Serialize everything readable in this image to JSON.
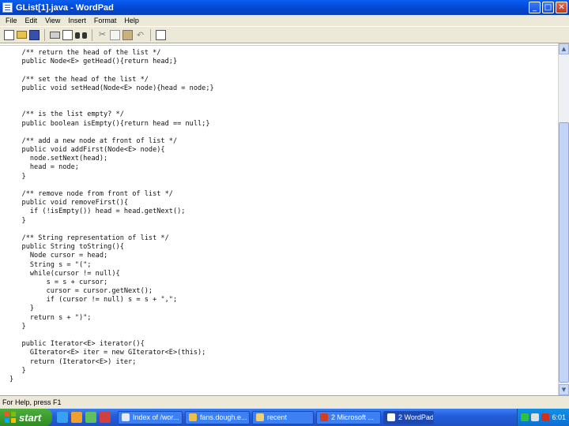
{
  "window": {
    "title": "GList[1].java - WordPad",
    "minimize_glyph": "_",
    "maximize_glyph": "□",
    "close_glyph": "✕"
  },
  "menu": [
    "File",
    "Edit",
    "View",
    "Insert",
    "Format",
    "Help"
  ],
  "toolbar": {
    "icons": [
      "new-document-icon",
      "open-folder-icon",
      "save-disk-icon",
      "print-icon",
      "print-preview-icon",
      "find-binoculars-icon",
      "cut-scissors-icon",
      "copy-icon",
      "paste-icon",
      "undo-icon",
      "date-time-icon"
    ],
    "cut_glyph": "✂",
    "undo_glyph": "↶"
  },
  "document": {
    "lines": [
      "   /** return the head of the list */",
      "   public Node<E> getHead(){return head;}",
      "",
      "   /** set the head of the list */",
      "   public void setHead(Node<E> node){head = node;}",
      "",
      "",
      "   /** is the list empty? */",
      "   public boolean isEmpty(){return head == null;}",
      "",
      "   /** add a new node at front of list */",
      "   public void addFirst(Node<E> node){",
      "     node.setNext(head);",
      "     head = node;",
      "   }",
      "",
      "   /** remove node from front of list */",
      "   public void removeFirst(){",
      "     if (!isEmpty()) head = head.getNext();",
      "   }",
      "",
      "   /** String representation of list */",
      "   public String toString(){",
      "     Node cursor = head;",
      "     String s = \"(\";",
      "     while(cursor != null){",
      "         s = s + cursor;",
      "         cursor = cursor.getNext();",
      "         if (cursor != null) s = s + \",\";",
      "     }",
      "     return s + \")\";",
      "   }",
      "",
      "   public Iterator<E> iterator(){",
      "     GIterator<E> iter = new GIterator<E>(this);",
      "     return (Iterator<E>) iter;",
      "   }",
      "}"
    ]
  },
  "scrollbar": {
    "up_glyph": "▲",
    "down_glyph": "▼"
  },
  "status": {
    "text": "For Help, press F1"
  },
  "taskbar": {
    "start_label": "start",
    "tasks": [
      {
        "label": "Index of /wor...",
        "color": "#e8e8f8"
      },
      {
        "label": "fans.dough.e...",
        "color": "#f0c040"
      },
      {
        "label": "recent",
        "color": "#f0d070"
      },
      {
        "label": "2 Microsoft ...",
        "color": "#d04020"
      },
      {
        "label": "2 WordPad",
        "color": "#ffffff"
      }
    ],
    "clock": "6:01"
  }
}
